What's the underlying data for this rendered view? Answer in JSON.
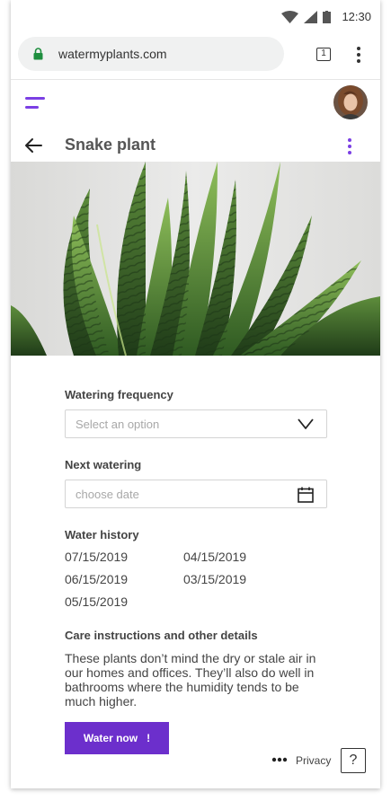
{
  "status_bar": {
    "time": "12:30"
  },
  "browser": {
    "url": "watermyplants.com",
    "tab_count": "1"
  },
  "header": {
    "title": "Snake plant"
  },
  "watering_frequency": {
    "label": "Watering frequency",
    "placeholder": "Select an option"
  },
  "next_watering": {
    "label": "Next watering",
    "placeholder": "choose date"
  },
  "water_history": {
    "label": "Water history",
    "dates": [
      "07/15/2019",
      "04/15/2019",
      "06/15/2019",
      "03/15/2019",
      "05/15/2019"
    ]
  },
  "care": {
    "label": "Care instructions and other details",
    "lines": [
      "These plants don’t mind the dry or stale air in",
      "our homes and offices. They’ll also do well in",
      "bathrooms where the humidity tends to be",
      "much higher."
    ]
  },
  "actions": {
    "water_now_label": "Water now",
    "water_now_icon": "!"
  },
  "footer": {
    "privacy_label": "Privacy",
    "help_label": "?"
  },
  "colors": {
    "accent": "#6c2fcc",
    "hamburger": "#7b3fe4"
  }
}
